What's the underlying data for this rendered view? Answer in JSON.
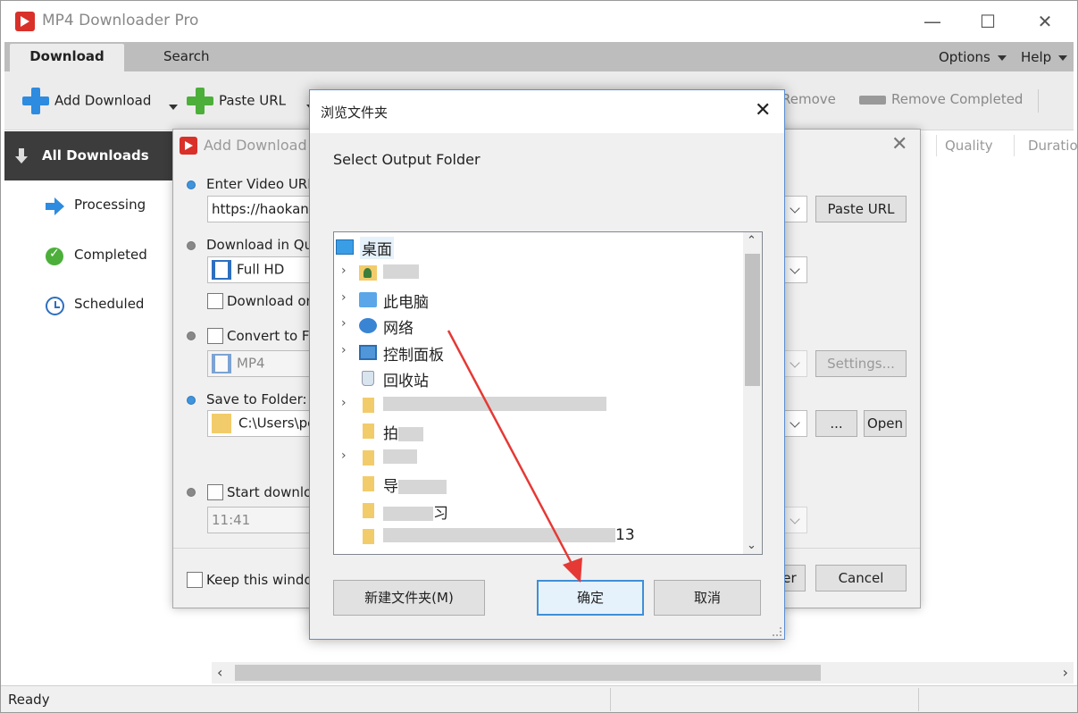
{
  "window": {
    "title": "MP4 Downloader Pro",
    "controls": {
      "minimize": "—",
      "maximize": "☐",
      "close": "✕"
    }
  },
  "tabs": [
    {
      "label": "Download",
      "active": true
    },
    {
      "label": "Search",
      "active": false
    }
  ],
  "menus": {
    "options": "Options",
    "help": "Help"
  },
  "toolbar": {
    "add_download": "Add Download",
    "paste_url": "Paste URL",
    "remove": "Remove",
    "remove_completed": "Remove Completed"
  },
  "sidebar": {
    "all_downloads": "All Downloads",
    "items": [
      {
        "label": "Processing",
        "icon": "arrow-right-icon"
      },
      {
        "label": "Completed",
        "icon": "check-icon"
      },
      {
        "label": "Scheduled",
        "icon": "clock-icon"
      }
    ]
  },
  "list_columns": {
    "quality": "Quality",
    "duration": "Duration"
  },
  "status": {
    "text": "Ready"
  },
  "add_dialog": {
    "title": "Add Download",
    "enter_url_label": "Enter Video URL:",
    "url_value": "https://haokan.b",
    "paste_url_btn": "Paste URL",
    "quality_label": "Download in Qual",
    "quality_value": "Full HD",
    "download_only_label": "Download only",
    "convert_label": "Convert to Fo",
    "convert_value": "MP4",
    "settings_btn": "Settings...",
    "save_label": "Save to Folder:",
    "folder_value": "C:\\Users\\pc",
    "browse_btn": "...",
    "open_btn": "Open",
    "start_label": "Start downloa",
    "time_value": "11:41",
    "keep_window_label": "Keep this window",
    "ok_partial": "er",
    "cancel_btn": "Cancel"
  },
  "browse_dialog": {
    "title": "浏览文件夹",
    "close": "✕",
    "description": "Select Output Folder",
    "tree": [
      {
        "label": "桌面",
        "icon": "desktop-icon",
        "expandable": false,
        "root": true
      },
      {
        "label": "",
        "icon": "user-folder-icon",
        "expandable": true
      },
      {
        "label": "此电脑",
        "icon": "computer-icon",
        "expandable": true
      },
      {
        "label": "网络",
        "icon": "network-icon",
        "expandable": true
      },
      {
        "label": "控制面板",
        "icon": "control-panel-icon",
        "expandable": true
      },
      {
        "label": "回收站",
        "icon": "recycle-bin-icon",
        "expandable": false
      },
      {
        "label": "",
        "icon": "folder-icon",
        "expandable": true
      },
      {
        "label": "拍",
        "icon": "folder-icon",
        "expandable": false
      },
      {
        "label": "",
        "icon": "folder-icon",
        "expandable": true
      },
      {
        "label": "导",
        "icon": "folder-icon",
        "expandable": false
      },
      {
        "label": "习",
        "icon": "folder-icon",
        "expandable": false
      },
      {
        "label": "13",
        "icon": "folder-icon",
        "expandable": false
      }
    ],
    "new_folder_btn": "新建文件夹(M)",
    "ok_btn": "确定",
    "cancel_btn": "取消"
  },
  "colors": {
    "accent": "#3f8fd8",
    "annotation": "#e53935",
    "sidebar_active": "#3c3c3c"
  }
}
